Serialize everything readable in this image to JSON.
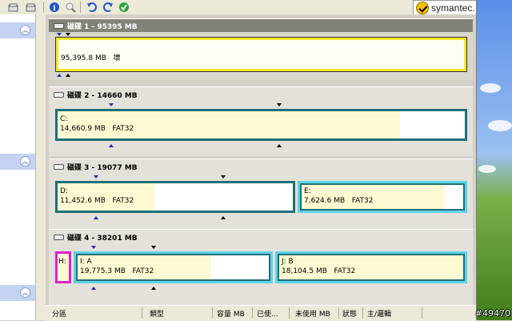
{
  "toolbar": {
    "icons": [
      "disk-icon",
      "disk-icon",
      "info-icon",
      "magnify-icon",
      "undo-icon",
      "redo-icon",
      "apply-check-icon"
    ]
  },
  "logo": {
    "text": "symantec."
  },
  "disks": [
    {
      "title": "磁碟 1 - 95395 MB",
      "partitions": [
        {
          "label": "",
          "size": "95,395.8 MB",
          "fs": "壞"
        }
      ]
    },
    {
      "title": "磁碟 2 - 14660 MB",
      "partitions": [
        {
          "label": "C:",
          "size": "14,660.9 MB",
          "fs": "FAT32"
        }
      ]
    },
    {
      "title": "磁碟 3 - 19077 MB",
      "partitions": [
        {
          "label": "D:",
          "size": "11,452.6 MB",
          "fs": "FAT32"
        },
        {
          "label": "E:",
          "size": "7,624.6 MB",
          "fs": "FAT32"
        }
      ]
    },
    {
      "title": "磁碟 4 - 38201 MB",
      "partitions": [
        {
          "label": "H:",
          "size": "",
          "fs": ""
        },
        {
          "label": "I:  A",
          "size": "19,775.3 MB",
          "fs": "FAT32"
        },
        {
          "label": "J:  B",
          "size": "18,104.5 MB",
          "fs": "FAT32"
        }
      ]
    }
  ],
  "table_header": {
    "columns": [
      "分區",
      "類型",
      "容量 MB",
      "已使...",
      "未使用 MB",
      "狀態",
      "主/邏輯"
    ]
  },
  "watermark": "#49470",
  "colors": {
    "selected_border": "#f5e72a",
    "primary_border": "#1f6f78",
    "logical_border": "#5fd3e6",
    "hidden_border": "#e020c8",
    "used_fill": "#fdf9d2"
  }
}
